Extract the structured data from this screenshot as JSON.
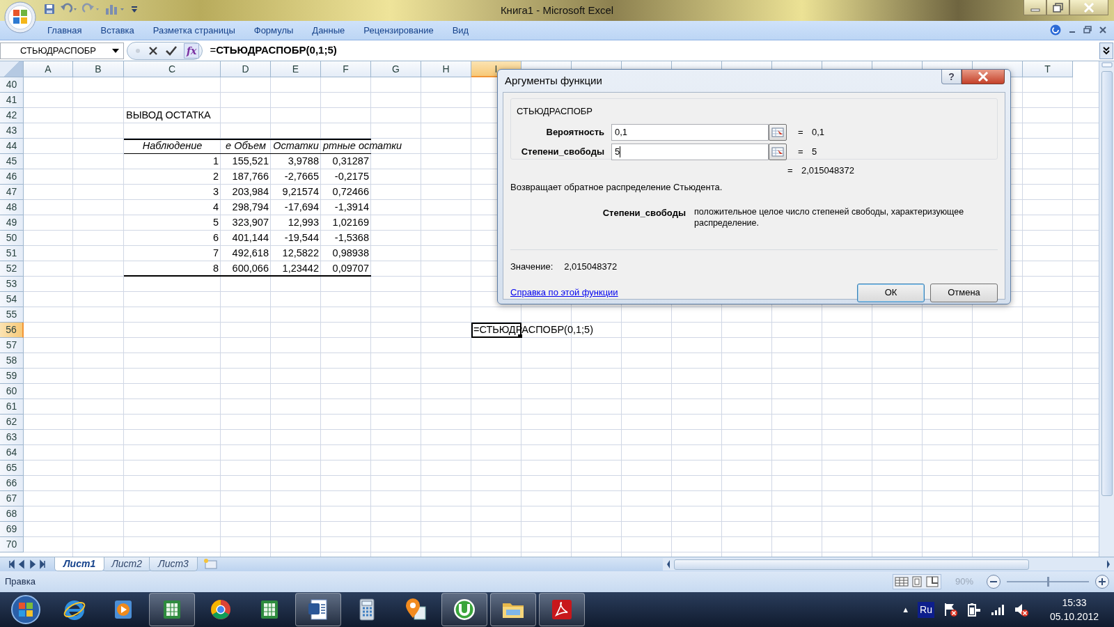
{
  "window": {
    "title": "Книга1 - Microsoft Excel"
  },
  "ribbon_tabs": [
    "Главная",
    "Вставка",
    "Разметка страницы",
    "Формулы",
    "Данные",
    "Рецензирование",
    "Вид"
  ],
  "formula_bar": {
    "name_box": "СТЬЮДРАСПОБР",
    "function_button": "fx",
    "formula": "=**СТЬЮДРАСПОБР(0,1;5)**"
  },
  "sheet": {
    "columns": [
      {
        "label": "A",
        "selected": false
      },
      {
        "label": "B",
        "selected": false
      },
      {
        "label": "C",
        "selected": false
      },
      {
        "label": "D",
        "selected": false
      },
      {
        "label": "E",
        "selected": false
      },
      {
        "label": "F",
        "selected": false
      },
      {
        "label": "G",
        "selected": false
      },
      {
        "label": "H",
        "selected": false
      },
      {
        "label": "I",
        "selected": true
      },
      {
        "selected": false
      },
      {
        "selected": false
      },
      {
        "selected": false
      },
      {
        "selected": false
      },
      {
        "selected": false
      },
      {
        "selected": false
      },
      {
        "selected": false
      },
      {
        "selected": false
      },
      {
        "selected": false
      },
      {
        "selected": false
      },
      {
        "label": "T",
        "selected": false
      }
    ],
    "rows": [
      {
        "number": "40",
        "selected": false,
        "cells": {}
      },
      {
        "number": "41",
        "selected": false,
        "cells": {}
      },
      {
        "number": "42",
        "selected": false,
        "cells": {
          "C": {
            "text": "ВЫВОД ОСТАТКА",
            "kind": "title"
          }
        }
      },
      {
        "number": "43",
        "selected": false,
        "cells": {}
      },
      {
        "number": "44",
        "selected": false,
        "cells": {
          "C": {
            "text": "Наблюдение",
            "kind": "header"
          },
          "D": {
            "text": "е Объем",
            "kind": "header"
          },
          "E": {
            "text": "Остатки",
            "kind": "header"
          },
          "F": {
            "text": "ртные остатки",
            "kind": "header"
          }
        }
      },
      {
        "number": "45",
        "selected": false,
        "cells": {
          "C": {
            "text": "1",
            "kind": "value"
          },
          "D": {
            "text": "155,521",
            "kind": "value"
          },
          "E": {
            "text": "3,9788",
            "kind": "value"
          },
          "F": {
            "text": "0,31287",
            "kind": "value"
          }
        }
      },
      {
        "number": "46",
        "selected": false,
        "cells": {
          "C": {
            "text": "2",
            "kind": "value"
          },
          "D": {
            "text": "187,766",
            "kind": "value"
          },
          "E": {
            "text": "-2,7665",
            "kind": "value"
          },
          "F": {
            "text": "-0,2175",
            "kind": "value"
          }
        }
      },
      {
        "number": "47",
        "selected": false,
        "cells": {
          "C": {
            "text": "3",
            "kind": "value"
          },
          "D": {
            "text": "203,984",
            "kind": "value"
          },
          "E": {
            "text": "9,21574",
            "kind": "value"
          },
          "F": {
            "text": "0,72466",
            "kind": "value"
          }
        }
      },
      {
        "number": "48",
        "selected": false,
        "cells": {
          "C": {
            "text": "4",
            "kind": "value"
          },
          "D": {
            "text": "298,794",
            "kind": "value"
          },
          "E": {
            "text": "-17,694",
            "kind": "value"
          },
          "F": {
            "text": "-1,3914",
            "kind": "value"
          }
        }
      },
      {
        "number": "49",
        "selected": false,
        "cells": {
          "C": {
            "text": "5",
            "kind": "value"
          },
          "D": {
            "text": "323,907",
            "kind": "value"
          },
          "E": {
            "text": "12,993",
            "kind": "value"
          },
          "F": {
            "text": "1,02169",
            "kind": "value"
          }
        }
      },
      {
        "number": "50",
        "selected": false,
        "cells": {
          "C": {
            "text": "6",
            "kind": "value"
          },
          "D": {
            "text": "401,144",
            "kind": "value"
          },
          "E": {
            "text": "-19,544",
            "kind": "value"
          },
          "F": {
            "text": "-1,5368",
            "kind": "value"
          }
        }
      },
      {
        "number": "51",
        "selected": false,
        "cells": {
          "C": {
            "text": "7",
            "kind": "value"
          },
          "D": {
            "text": "492,618",
            "kind": "value"
          },
          "E": {
            "text": "12,5822",
            "kind": "value"
          },
          "F": {
            "text": "0,98938",
            "kind": "value"
          }
        }
      },
      {
        "number": "52",
        "selected": false,
        "cells": {
          "C": {
            "text": "8",
            "kind": "value_last"
          },
          "D": {
            "text": "600,066",
            "kind": "value_last"
          },
          "E": {
            "text": "1,23442",
            "kind": "value_last"
          },
          "F": {
            "text": "0,09707",
            "kind": "value_last"
          }
        }
      },
      {
        "number": "53",
        "selected": false,
        "cells": {}
      },
      {
        "number": "54",
        "selected": false,
        "cells": {}
      },
      {
        "number": "55",
        "selected": false,
        "cells": {}
      },
      {
        "number": "56",
        "selected": true,
        "cells": {
          "I": {
            "text": "=СТЬЮДРАСПОБР(0,1;5)",
            "kind": "active"
          }
        }
      },
      {
        "number": "57",
        "selected": false,
        "cells": {}
      },
      {
        "number": "58",
        "selected": false,
        "cells": {}
      },
      {
        "number": "59",
        "selected": false,
        "cells": {}
      },
      {
        "number": "60",
        "selected": false,
        "cells": {}
      },
      {
        "number": "61",
        "selected": false,
        "cells": {}
      },
      {
        "number": "62",
        "selected": false,
        "cells": {}
      },
      {
        "number": "63",
        "selected": false,
        "cells": {}
      },
      {
        "number": "64",
        "selected": false,
        "cells": {}
      },
      {
        "number": "65",
        "selected": false,
        "cells": {}
      },
      {
        "number": "66",
        "selected": false,
        "cells": {}
      },
      {
        "number": "67",
        "selected": false,
        "cells": {}
      },
      {
        "number": "68",
        "selected": false,
        "cells": {}
      },
      {
        "number": "69",
        "selected": false,
        "cells": {}
      },
      {
        "number": "70",
        "selected": false,
        "cells": {}
      }
    ]
  },
  "dialog": {
    "title": "Аргументы функции",
    "help_button": "?",
    "function_name": "СТЬЮДРАСПОБР",
    "arguments": [
      {
        "label": "Вероятность",
        "value": "0,1",
        "focused": false,
        "equals": "=",
        "result": "0,1"
      },
      {
        "label": "Степени_свободы",
        "value": "5",
        "focused": true,
        "equals": "=",
        "result": "5"
      }
    ],
    "result_equals": "=",
    "result": "2,015048372",
    "description": "Возвращает обратное распределение Стьюдента.",
    "argument_help": {
      "label": "Степени_свободы",
      "text": "положительное целое число степеней свободы, характеризующее распределение."
    },
    "value_label": "Значение:",
    "value": "2,015048372",
    "help_link": "Справка по этой функции",
    "buttons": [
      {
        "label": "ОК",
        "default": true
      },
      {
        "label": "Отмена",
        "default": false
      }
    ]
  },
  "sheet_tabs": [
    {
      "label": "Лист1",
      "selected": true
    },
    {
      "label": "Лист2",
      "selected": false
    },
    {
      "label": "Лист3",
      "selected": false
    }
  ],
  "status_bar": {
    "mode": "Правка",
    "zoom": "90%",
    "zoom_slider": {
      "level": 0.5
    }
  },
  "taskbar": {
    "apps": [
      {
        "kind": "ie",
        "running": false
      },
      {
        "kind": "media",
        "running": false
      },
      {
        "kind": "excel",
        "running": true
      },
      {
        "kind": "chrome",
        "running": false
      },
      {
        "kind": "excel",
        "running": false
      },
      {
        "kind": "word",
        "running": true
      },
      {
        "kind": "calculator",
        "running": false
      },
      {
        "kind": "map",
        "running": false
      },
      {
        "kind": "torrent",
        "running": true
      },
      {
        "kind": "folder",
        "running": true
      },
      {
        "kind": "pdf",
        "running": true
      }
    ],
    "tray": {
      "arrow": "▲",
      "language": "Ru",
      "time": "15:33",
      "date": "05.10.2012"
    }
  }
}
